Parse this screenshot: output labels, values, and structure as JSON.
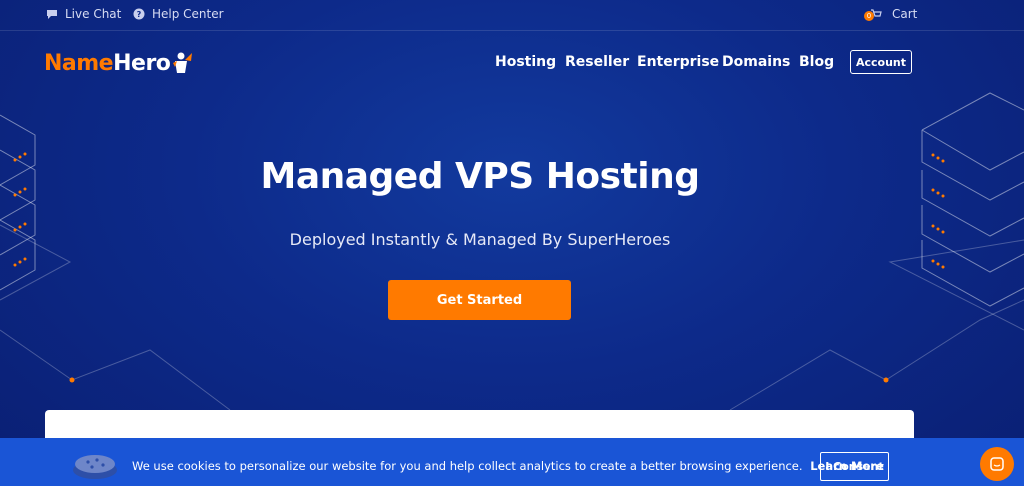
{
  "topbar": {
    "live_chat": "Live Chat",
    "help_center": "Help Center",
    "cart_label": "Cart",
    "cart_count": "0"
  },
  "logo": {
    "name_part": "Name",
    "hero_part": "Hero"
  },
  "nav": {
    "items": [
      {
        "label": "Hosting"
      },
      {
        "label": "Reseller"
      },
      {
        "label": "Enterprise"
      },
      {
        "label": "Domains"
      },
      {
        "label": "Blog"
      }
    ],
    "account_label": "Account"
  },
  "hero": {
    "title": "Managed VPS Hosting",
    "subtitle": "Deployed Instantly & Managed By SuperHeroes",
    "cta_label": "Get Started"
  },
  "cookie": {
    "text": "We use cookies to personalize our website for you and help collect analytics to create a better browsing experience.",
    "learn_more": "Learn More",
    "consent_label": "I Consent"
  },
  "colors": {
    "background": "#0d2a8a",
    "accent": "#ff7a00",
    "cookie_bar": "#1a55d6"
  },
  "icons": {
    "live_chat": "chat-bubble-icon",
    "help_center": "question-circle-icon",
    "cart": "cart-icon",
    "chat_widget": "chat-widget-icon",
    "cookie": "cookie-icon"
  }
}
